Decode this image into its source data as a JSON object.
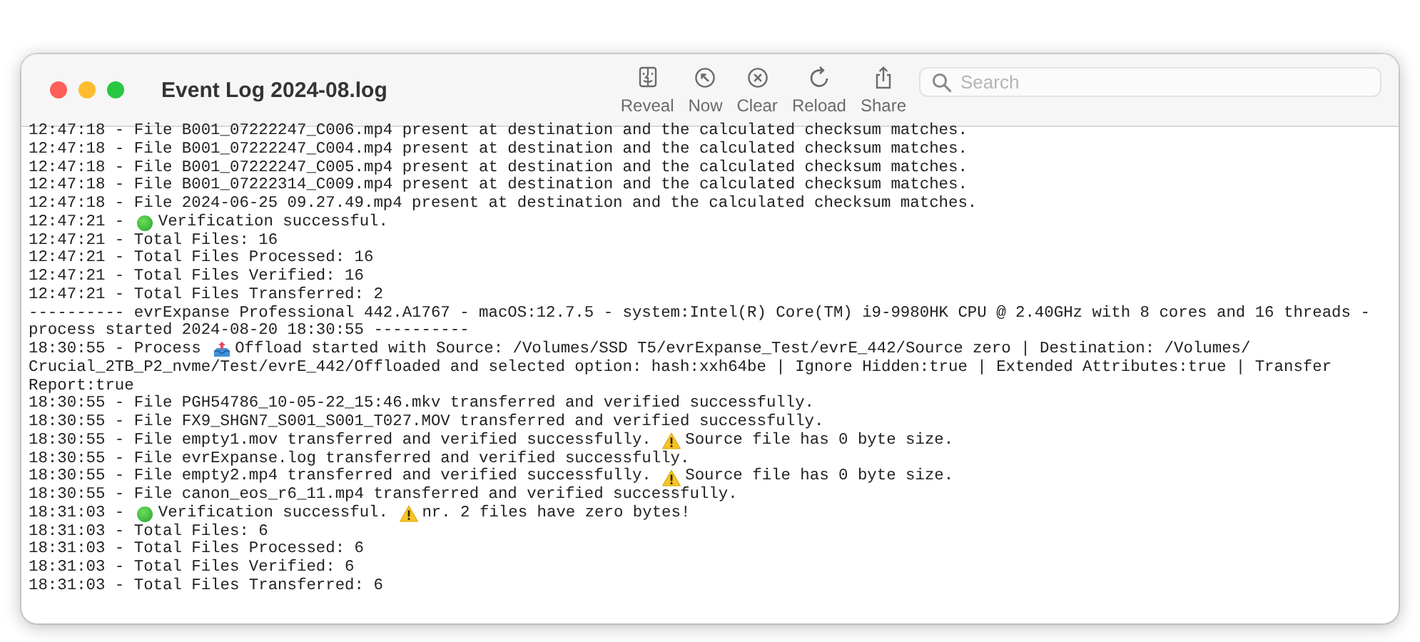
{
  "window": {
    "title": "Event Log 2024-08.log"
  },
  "toolbar": [
    {
      "kind": "reveal",
      "label": "Reveal"
    },
    {
      "kind": "now",
      "label": "Now"
    },
    {
      "kind": "clear",
      "label": "Clear"
    },
    {
      "kind": "reload",
      "label": "Reload"
    },
    {
      "kind": "share",
      "label": "Share"
    }
  ],
  "search": {
    "placeholder": "Search"
  },
  "log": [
    [
      "12:47:18 - File B001_07222247_C006.mp4 present at destination and the calculated checksum matches."
    ],
    [
      "12:47:18 - File B001_07222247_C004.mp4 present at destination and the calculated checksum matches."
    ],
    [
      "12:47:18 - File B001_07222247_C005.mp4 present at destination and the calculated checksum matches."
    ],
    [
      "12:47:18 - File B001_07222314_C009.mp4 present at destination and the calculated checksum matches."
    ],
    [
      "12:47:18 - File 2024-06-25 09.27.49.mp4 present at destination and the calculated checksum matches."
    ],
    [
      "12:47:21 - ",
      {
        "kind": "dot"
      },
      "Verification successful."
    ],
    [
      "12:47:21 - Total Files: 16"
    ],
    [
      "12:47:21 - Total Files Processed: 16"
    ],
    [
      "12:47:21 - Total Files Verified: 16"
    ],
    [
      "12:47:21 - Total Files Transferred: 2"
    ],
    [
      "---------- evrExpanse Professional 442.A1767 - macOS:12.7.5 - system:Intel(R) Core(TM) i9-9980HK CPU @ 2.40GHz with 8 cores and 16 threads -"
    ],
    [
      "process started 2024-08-20 18:30:55 ----------"
    ],
    [
      "18:30:55 - Process ",
      {
        "kind": "tray"
      },
      "Offload started with Source: /Volumes/SSD T5/evrExpanse_Test/evrE_442/Source zero | Destination: /Volumes/"
    ],
    [
      "Crucial_2TB_P2_nvme/Test/evrE_442/Offloaded and selected option: hash:xxh64be | Ignore Hidden:true | Extended Attributes:true | Transfer"
    ],
    [
      "Report:true"
    ],
    [
      "18:30:55 - File PGH54786_10-05-22_15:46.mkv transferred and verified successfully."
    ],
    [
      "18:30:55 - File FX9_SHGN7_S001_S001_T027.MOV transferred and verified successfully."
    ],
    [
      "18:30:55 - File empty1.mov transferred and verified successfully. ",
      {
        "kind": "warning"
      },
      "Source file has 0 byte size."
    ],
    [
      "18:30:55 - File evrExpanse.log transferred and verified successfully."
    ],
    [
      "18:30:55 - File empty2.mp4 transferred and verified successfully. ",
      {
        "kind": "warning"
      },
      "Source file has 0 byte size."
    ],
    [
      "18:30:55 - File canon_eos_r6_11.mp4 transferred and verified successfully."
    ],
    [
      "18:31:03 - ",
      {
        "kind": "dot"
      },
      "Verification successful. ",
      {
        "kind": "warning"
      },
      "nr. 2 files have zero bytes!"
    ],
    [
      "18:31:03 - Total Files: 6"
    ],
    [
      "18:31:03 - Total Files Processed: 6"
    ],
    [
      "18:31:03 - Total Files Verified: 6"
    ],
    [
      "18:31:03 - Total Files Transferred: 6"
    ]
  ]
}
